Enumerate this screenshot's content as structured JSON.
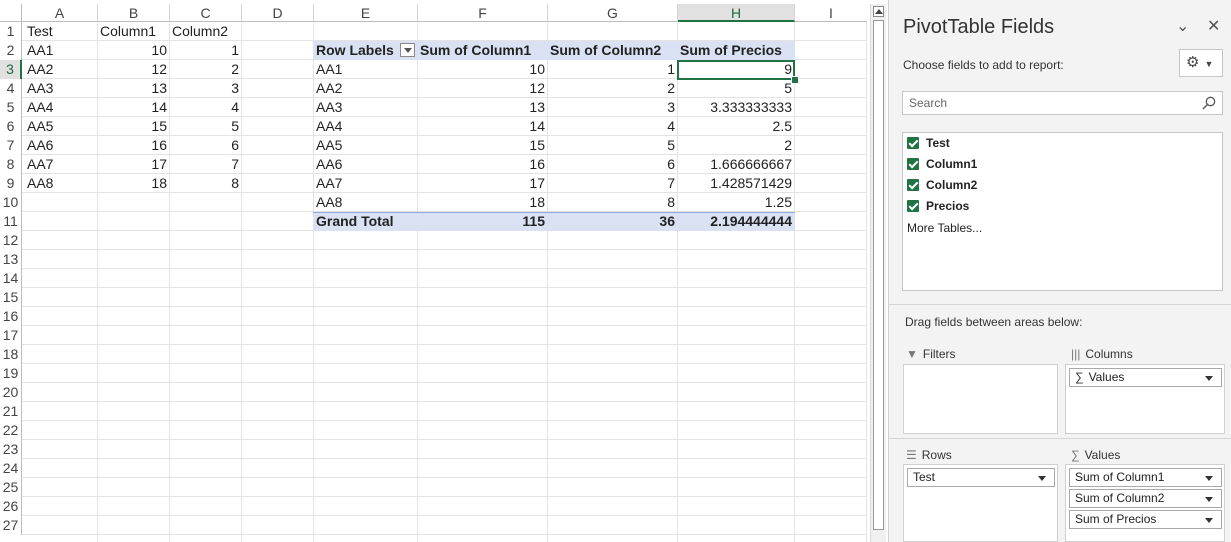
{
  "columns": [
    "A",
    "B",
    "C",
    "D",
    "E",
    "F",
    "G",
    "H",
    "I"
  ],
  "rows": [
    "1",
    "2",
    "3",
    "4",
    "5",
    "6",
    "7",
    "8",
    "9",
    "10",
    "11",
    "12",
    "13",
    "14",
    "15",
    "16",
    "17",
    "18",
    "19",
    "20",
    "21",
    "22",
    "23",
    "24",
    "25",
    "26",
    "27"
  ],
  "source_table": [
    {
      "a": "Test",
      "b": "Column1",
      "c": "Column2"
    },
    {
      "a": "AA1",
      "b": "10",
      "c": "1"
    },
    {
      "a": "AA2",
      "b": "12",
      "c": "2"
    },
    {
      "a": "AA3",
      "b": "13",
      "c": "3"
    },
    {
      "a": "AA4",
      "b": "14",
      "c": "4"
    },
    {
      "a": "AA5",
      "b": "15",
      "c": "5"
    },
    {
      "a": "AA6",
      "b": "16",
      "c": "6"
    },
    {
      "a": "AA7",
      "b": "17",
      "c": "7"
    },
    {
      "a": "AA8",
      "b": "18",
      "c": "8"
    }
  ],
  "pivot": {
    "headers": [
      "Row Labels",
      "Sum of Column1",
      "Sum of Column2",
      "Sum of Precios"
    ],
    "rows": [
      {
        "label": "AA1",
        "col1": "10",
        "col2": "1",
        "precios": "9"
      },
      {
        "label": "AA2",
        "col1": "12",
        "col2": "2",
        "precios": "5"
      },
      {
        "label": "AA3",
        "col1": "13",
        "col2": "3",
        "precios": "3.333333333"
      },
      {
        "label": "AA4",
        "col1": "14",
        "col2": "4",
        "precios": "2.5"
      },
      {
        "label": "AA5",
        "col1": "15",
        "col2": "5",
        "precios": "2"
      },
      {
        "label": "AA6",
        "col1": "16",
        "col2": "6",
        "precios": "1.666666667"
      },
      {
        "label": "AA7",
        "col1": "17",
        "col2": "7",
        "precios": "1.428571429"
      },
      {
        "label": "AA8",
        "col1": "18",
        "col2": "8",
        "precios": "1.25"
      }
    ],
    "grand_total": {
      "label": "Grand Total",
      "col1": "115",
      "col2": "36",
      "precios": "2.194444444"
    }
  },
  "pane": {
    "title": "PivotTable Fields",
    "choose_label": "Choose fields to add to report:",
    "search_placeholder": "Search",
    "fields": [
      "Test",
      "Column1",
      "Column2",
      "Precios"
    ],
    "more_tables": "More Tables...",
    "drag_label": "Drag fields between areas below:",
    "filters_label": "Filters",
    "columns_label": "Columns",
    "rows_label": "Rows",
    "values_label": "Values",
    "columns_items": [
      "Values"
    ],
    "rows_items": [
      "Test"
    ],
    "values_items": [
      "Sum of Column1",
      "Sum of Column2",
      "Sum of Precios"
    ]
  },
  "colors": {
    "accent": "#217346",
    "pivot_header": "#d9e1f2"
  }
}
